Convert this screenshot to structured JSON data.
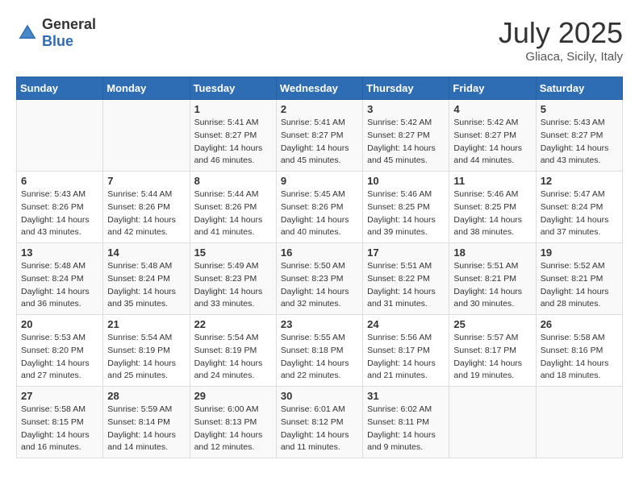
{
  "header": {
    "logo_general": "General",
    "logo_blue": "Blue",
    "month_title": "July 2025",
    "location": "Gliaca, Sicily, Italy"
  },
  "days_of_week": [
    "Sunday",
    "Monday",
    "Tuesday",
    "Wednesday",
    "Thursday",
    "Friday",
    "Saturday"
  ],
  "weeks": [
    [
      {
        "day": "",
        "info": ""
      },
      {
        "day": "",
        "info": ""
      },
      {
        "day": "1",
        "sunrise": "Sunrise: 5:41 AM",
        "sunset": "Sunset: 8:27 PM",
        "daylight": "Daylight: 14 hours and 46 minutes."
      },
      {
        "day": "2",
        "sunrise": "Sunrise: 5:41 AM",
        "sunset": "Sunset: 8:27 PM",
        "daylight": "Daylight: 14 hours and 45 minutes."
      },
      {
        "day": "3",
        "sunrise": "Sunrise: 5:42 AM",
        "sunset": "Sunset: 8:27 PM",
        "daylight": "Daylight: 14 hours and 45 minutes."
      },
      {
        "day": "4",
        "sunrise": "Sunrise: 5:42 AM",
        "sunset": "Sunset: 8:27 PM",
        "daylight": "Daylight: 14 hours and 44 minutes."
      },
      {
        "day": "5",
        "sunrise": "Sunrise: 5:43 AM",
        "sunset": "Sunset: 8:27 PM",
        "daylight": "Daylight: 14 hours and 43 minutes."
      }
    ],
    [
      {
        "day": "6",
        "sunrise": "Sunrise: 5:43 AM",
        "sunset": "Sunset: 8:26 PM",
        "daylight": "Daylight: 14 hours and 43 minutes."
      },
      {
        "day": "7",
        "sunrise": "Sunrise: 5:44 AM",
        "sunset": "Sunset: 8:26 PM",
        "daylight": "Daylight: 14 hours and 42 minutes."
      },
      {
        "day": "8",
        "sunrise": "Sunrise: 5:44 AM",
        "sunset": "Sunset: 8:26 PM",
        "daylight": "Daylight: 14 hours and 41 minutes."
      },
      {
        "day": "9",
        "sunrise": "Sunrise: 5:45 AM",
        "sunset": "Sunset: 8:26 PM",
        "daylight": "Daylight: 14 hours and 40 minutes."
      },
      {
        "day": "10",
        "sunrise": "Sunrise: 5:46 AM",
        "sunset": "Sunset: 8:25 PM",
        "daylight": "Daylight: 14 hours and 39 minutes."
      },
      {
        "day": "11",
        "sunrise": "Sunrise: 5:46 AM",
        "sunset": "Sunset: 8:25 PM",
        "daylight": "Daylight: 14 hours and 38 minutes."
      },
      {
        "day": "12",
        "sunrise": "Sunrise: 5:47 AM",
        "sunset": "Sunset: 8:24 PM",
        "daylight": "Daylight: 14 hours and 37 minutes."
      }
    ],
    [
      {
        "day": "13",
        "sunrise": "Sunrise: 5:48 AM",
        "sunset": "Sunset: 8:24 PM",
        "daylight": "Daylight: 14 hours and 36 minutes."
      },
      {
        "day": "14",
        "sunrise": "Sunrise: 5:48 AM",
        "sunset": "Sunset: 8:24 PM",
        "daylight": "Daylight: 14 hours and 35 minutes."
      },
      {
        "day": "15",
        "sunrise": "Sunrise: 5:49 AM",
        "sunset": "Sunset: 8:23 PM",
        "daylight": "Daylight: 14 hours and 33 minutes."
      },
      {
        "day": "16",
        "sunrise": "Sunrise: 5:50 AM",
        "sunset": "Sunset: 8:23 PM",
        "daylight": "Daylight: 14 hours and 32 minutes."
      },
      {
        "day": "17",
        "sunrise": "Sunrise: 5:51 AM",
        "sunset": "Sunset: 8:22 PM",
        "daylight": "Daylight: 14 hours and 31 minutes."
      },
      {
        "day": "18",
        "sunrise": "Sunrise: 5:51 AM",
        "sunset": "Sunset: 8:21 PM",
        "daylight": "Daylight: 14 hours and 30 minutes."
      },
      {
        "day": "19",
        "sunrise": "Sunrise: 5:52 AM",
        "sunset": "Sunset: 8:21 PM",
        "daylight": "Daylight: 14 hours and 28 minutes."
      }
    ],
    [
      {
        "day": "20",
        "sunrise": "Sunrise: 5:53 AM",
        "sunset": "Sunset: 8:20 PM",
        "daylight": "Daylight: 14 hours and 27 minutes."
      },
      {
        "day": "21",
        "sunrise": "Sunrise: 5:54 AM",
        "sunset": "Sunset: 8:19 PM",
        "daylight": "Daylight: 14 hours and 25 minutes."
      },
      {
        "day": "22",
        "sunrise": "Sunrise: 5:54 AM",
        "sunset": "Sunset: 8:19 PM",
        "daylight": "Daylight: 14 hours and 24 minutes."
      },
      {
        "day": "23",
        "sunrise": "Sunrise: 5:55 AM",
        "sunset": "Sunset: 8:18 PM",
        "daylight": "Daylight: 14 hours and 22 minutes."
      },
      {
        "day": "24",
        "sunrise": "Sunrise: 5:56 AM",
        "sunset": "Sunset: 8:17 PM",
        "daylight": "Daylight: 14 hours and 21 minutes."
      },
      {
        "day": "25",
        "sunrise": "Sunrise: 5:57 AM",
        "sunset": "Sunset: 8:17 PM",
        "daylight": "Daylight: 14 hours and 19 minutes."
      },
      {
        "day": "26",
        "sunrise": "Sunrise: 5:58 AM",
        "sunset": "Sunset: 8:16 PM",
        "daylight": "Daylight: 14 hours and 18 minutes."
      }
    ],
    [
      {
        "day": "27",
        "sunrise": "Sunrise: 5:58 AM",
        "sunset": "Sunset: 8:15 PM",
        "daylight": "Daylight: 14 hours and 16 minutes."
      },
      {
        "day": "28",
        "sunrise": "Sunrise: 5:59 AM",
        "sunset": "Sunset: 8:14 PM",
        "daylight": "Daylight: 14 hours and 14 minutes."
      },
      {
        "day": "29",
        "sunrise": "Sunrise: 6:00 AM",
        "sunset": "Sunset: 8:13 PM",
        "daylight": "Daylight: 14 hours and 12 minutes."
      },
      {
        "day": "30",
        "sunrise": "Sunrise: 6:01 AM",
        "sunset": "Sunset: 8:12 PM",
        "daylight": "Daylight: 14 hours and 11 minutes."
      },
      {
        "day": "31",
        "sunrise": "Sunrise: 6:02 AM",
        "sunset": "Sunset: 8:11 PM",
        "daylight": "Daylight: 14 hours and 9 minutes."
      },
      {
        "day": "",
        "info": ""
      },
      {
        "day": "",
        "info": ""
      }
    ]
  ]
}
